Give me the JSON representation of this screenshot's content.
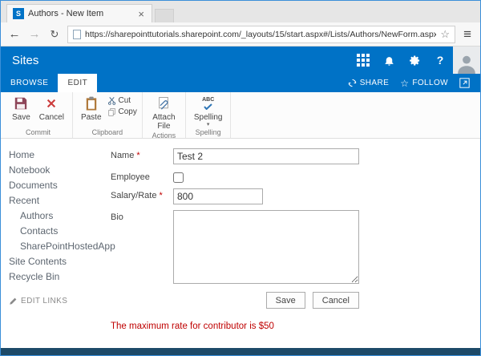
{
  "browser": {
    "tab_title": "Authors - New Item",
    "favicon_letter": "S",
    "close_glyph": "×",
    "back_glyph": "←",
    "forward_glyph": "→",
    "refresh_glyph": "↻",
    "url": "https://sharepointtutorials.sharepoint.com/_layouts/15/start.aspx#/Lists/Authors/NewForm.aspx?Source=https%3",
    "favorites_glyph": "☆",
    "menu_glyph": "≡"
  },
  "suitebar": {
    "title": "Sites",
    "help_glyph": "?"
  },
  "ribbon": {
    "tabs": [
      {
        "label": "BROWSE"
      },
      {
        "label": "EDIT"
      }
    ],
    "share_label": "SHARE",
    "follow_label": "FOLLOW",
    "follow_glyph": "☆",
    "commit": {
      "save": "Save",
      "cancel": "Cancel",
      "group_label": "Commit"
    },
    "clipboard": {
      "paste": "Paste",
      "cut": "Cut",
      "copy": "Copy",
      "group_label": "Clipboard"
    },
    "actions": {
      "attach": "Attach File",
      "group_label": "Actions"
    },
    "spelling": {
      "button": "Spelling",
      "icon_text": "ABC",
      "dropdown_glyph": "▾",
      "group_label": "Spelling"
    }
  },
  "sidebar": {
    "items": [
      {
        "label": "Home",
        "indent": false
      },
      {
        "label": "Notebook",
        "indent": false
      },
      {
        "label": "Documents",
        "indent": false
      },
      {
        "label": "Recent",
        "indent": false
      },
      {
        "label": "Authors",
        "indent": true
      },
      {
        "label": "Contacts",
        "indent": true
      },
      {
        "label": "SharePointHostedApp",
        "indent": true
      },
      {
        "label": "Site Contents",
        "indent": false
      },
      {
        "label": "Recycle Bin",
        "indent": false
      }
    ],
    "edit_links": "EDIT LINKS"
  },
  "form": {
    "fields": {
      "name": {
        "label": "Name",
        "required": "*",
        "value": "Test 2"
      },
      "employee": {
        "label": "Employee",
        "checked": false
      },
      "salary": {
        "label": "Salary/Rate",
        "required": "*",
        "value": "800"
      },
      "bio": {
        "label": "Bio",
        "value": ""
      }
    },
    "save_label": "Save",
    "cancel_label": "Cancel",
    "error_message": "The maximum rate for contributor is $50"
  },
  "colors": {
    "suitebar_blue": "#0072c6",
    "error_red": "#bf0000",
    "window_border": "#3b8fd9"
  }
}
